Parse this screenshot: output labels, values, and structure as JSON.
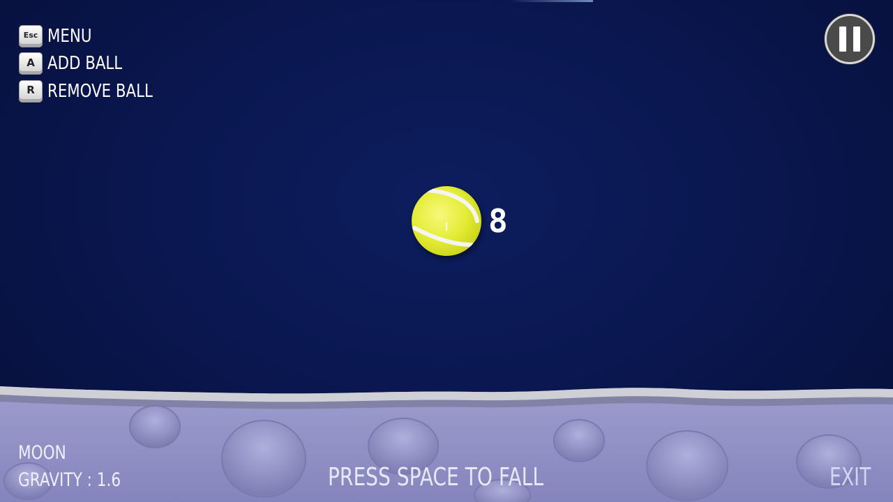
{
  "controls": [
    {
      "key": "Esc",
      "label": "MENU"
    },
    {
      "key": "A",
      "label": "ADD BALL"
    },
    {
      "key": "R",
      "label": "REMOVE BALL"
    }
  ],
  "pause_button": {
    "icon": "pause-icon"
  },
  "ball": {
    "icon": "tennis-ball-icon",
    "color": "#e4ec36"
  },
  "ball_count": "8",
  "planet": {
    "name": "MOON",
    "gravity": "GRAVITY : 1.6"
  },
  "prompt": "PRESS SPACE TO FALL",
  "exit_label": "EXIT",
  "colors": {
    "sky": "#0a1750",
    "ground": "#8f8fc4",
    "ground_edge": "#c9c9cf"
  }
}
